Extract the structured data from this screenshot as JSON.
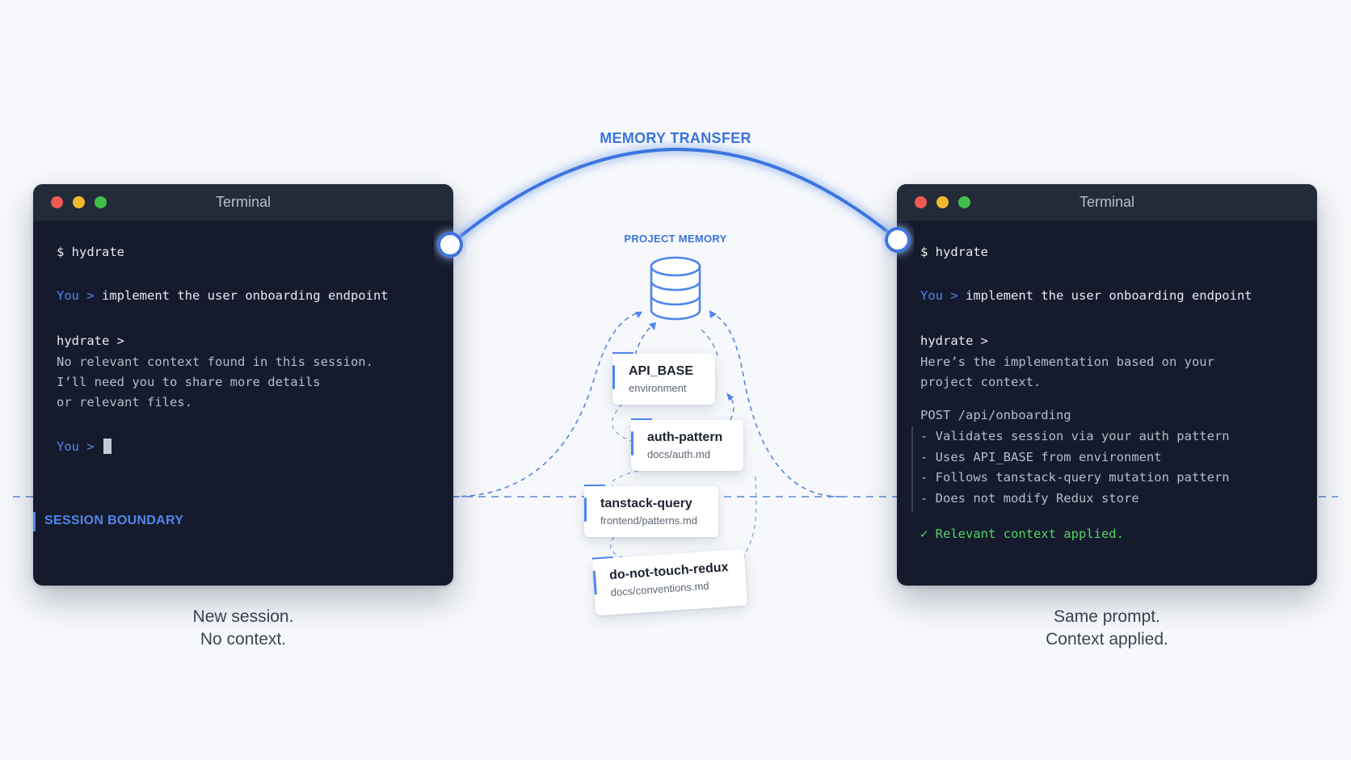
{
  "memory_transfer_label": "MEMORY TRANSFER",
  "project_memory_label": "PROJECT MEMORY",
  "left_terminal": {
    "title": "Terminal",
    "command": "$ hydrate",
    "user_prefix": "You >",
    "user_prompt": "implement the user onboarding endpoint",
    "assistant_prefix": "hydrate >",
    "response_lines": [
      "No relevant context found in this session.",
      "I’ll need you to share more details",
      "or relevant files."
    ],
    "second_user_prefix": "You >",
    "session_boundary": "SESSION BOUNDARY"
  },
  "right_terminal": {
    "title": "Terminal",
    "command": "$ hydrate",
    "user_prefix": "You >",
    "user_prompt": "implement the user onboarding endpoint",
    "assistant_prefix": "hydrate >",
    "response_lines": [
      "Here’s the implementation based on your",
      "project context."
    ],
    "endpoint": "POST /api/onboarding",
    "bullets": [
      "- Validates session via your auth pattern",
      "- Uses API_BASE from environment",
      "- Follows tanstack-query mutation pattern",
      "- Does not modify Redux store"
    ],
    "status": "✓ Relevant context applied."
  },
  "memory_cards": [
    {
      "name": "API_BASE",
      "source": "environment"
    },
    {
      "name": "auth-pattern",
      "source": "docs/auth.md"
    },
    {
      "name": "tanstack-query",
      "source": "frontend/patterns.md"
    },
    {
      "name": "do-not-touch-redux",
      "source": "docs/conventions.md"
    }
  ],
  "captions": {
    "left": [
      "New session.",
      "No context."
    ],
    "right": [
      "Same prompt.",
      "Context applied."
    ]
  },
  "colors": {
    "accent_blue": "#3b74e0",
    "terminal_bg": "#151b2c",
    "success_green": "#54d36a"
  },
  "icons": [
    "database-icon"
  ]
}
